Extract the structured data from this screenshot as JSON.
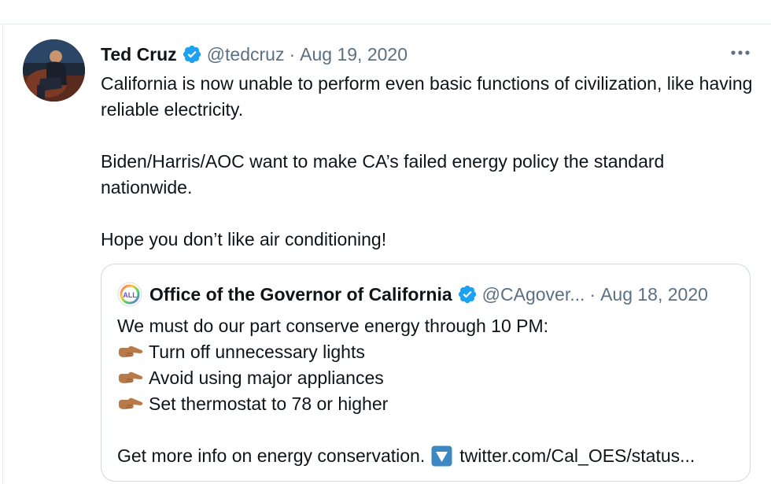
{
  "tweet": {
    "author_name": "Ted Cruz",
    "handle": "@tedcruz",
    "separator": "·",
    "date": "Aug 19, 2020",
    "more_label": "•••",
    "paragraphs": [
      "California is now unable to perform even basic functions of civilization, like having reliable electricity.",
      "Biden/Harris/AOC want to make CA’s failed energy policy the standard nationwide.",
      "Hope you don’t like air conditioning!"
    ]
  },
  "quoted_tweet": {
    "author_name": "Office of the Governor of California",
    "handle": "@CAgover...",
    "separator": "·",
    "date": "Aug 18, 2020",
    "avatar_text": "ALL",
    "intro": "We must do our part conserve energy through 10 PM:",
    "items": [
      "Turn off unnecessary lights",
      "Avoid using major appliances",
      "Set thermostat to 78 or higher"
    ],
    "footer_text": "Get more info on energy conservation.",
    "footer_link": "twitter.com/Cal_OES/status..."
  },
  "colors": {
    "verified": "#1da1f2",
    "secondary_text": "#5b7083",
    "border": "#cfd9de",
    "hand_emoji": "#b97a4a",
    "down_button": "#3b88c3"
  },
  "icons": {
    "verified": "verified-badge-icon",
    "more": "more-horizontal-icon",
    "pointing": "backhand-index-pointing-right-icon",
    "down_button": "down-arrow-button-icon"
  }
}
